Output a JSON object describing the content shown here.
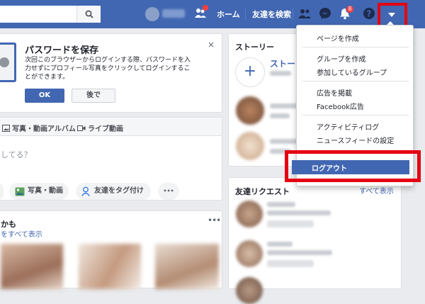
{
  "topbar": {
    "home_label": "ホーム",
    "find_friends_label": "友達を検索",
    "notification_count": "8",
    "icons": [
      "search-icon",
      "friend-requests-icon",
      "messenger-icon",
      "notifications-icon",
      "help-icon",
      "account-menu-icon"
    ]
  },
  "password_prompt": {
    "title": "パスワードを保存",
    "line1": "次回このブラウザーからログインする際、パスワードを入",
    "line2": "力せずにプロフィール写真をクリックしてログインするこ",
    "line3": "とができます。",
    "ok_label": "OK",
    "later_label": "後で",
    "close_glyph": "×"
  },
  "composer": {
    "tab_photo_album": "写真・動画アルバム",
    "tab_live": "ライブ動画",
    "placeholder": "してる？",
    "photo_video_label": "写真・動画",
    "tag_friends_label": "友達をタグ付け",
    "more_glyph": "•••"
  },
  "pymk": {
    "title": "かも",
    "link": "をすべて表示",
    "more_glyph": "•••"
  },
  "stories": {
    "title": "ストーリー",
    "add_label": "ストーリ",
    "plus_glyph": "+"
  },
  "friend_requests": {
    "title": "友達リクエスト",
    "see_all": "すべて表示"
  },
  "dropdown": {
    "items": [
      "ページを作成",
      "グループを作成",
      "参加しているグループ",
      "広告を掲載",
      "Facebook広告",
      "アクティビティログ",
      "ニュースフィードの設定"
    ],
    "logout_label": "ログアウト"
  },
  "colors": {
    "brand_blue": "#4267b2",
    "highlight_red": "#e50012",
    "badge_red": "#fa3e3e"
  }
}
